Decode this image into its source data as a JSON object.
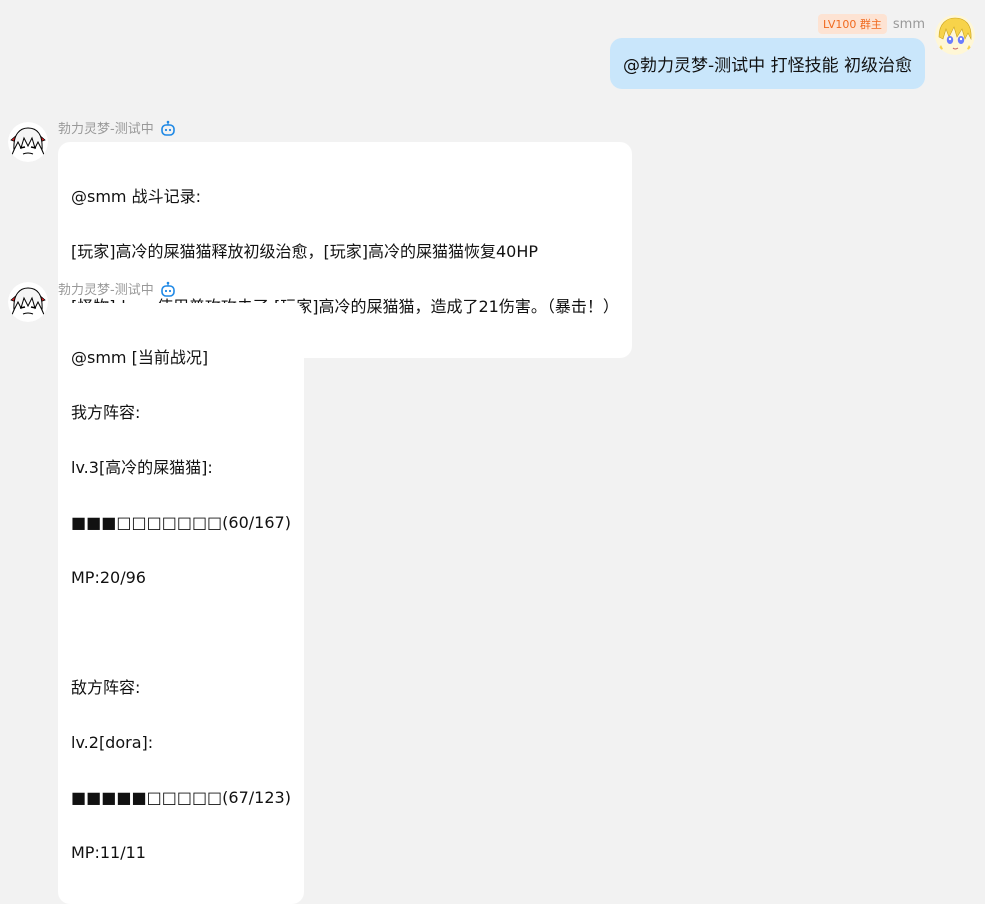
{
  "self_message": {
    "badge": "LV100 群主",
    "sender": "smm",
    "text": "@勃力灵梦-测试中 打怪技能 初级治愈"
  },
  "bot_messages": [
    {
      "sender": "勃力灵梦-测试中",
      "lines": [
        "@smm 战斗记录:",
        "[玩家]高冷的屎猫猫释放初级治愈，[玩家]高冷的屎猫猫恢复40HP",
        "[怪物]dora 使用普攻攻击了 [玩家]高冷的屎猫猫，造成了21伤害。（暴击！）"
      ]
    },
    {
      "sender": "勃力灵梦-测试中",
      "lines": [
        "@smm [当前战况]",
        "我方阵容:",
        "lv.3[高冷的屎猫猫]:",
        "■■■□□□□□□□(60/167)",
        "MP:20/96",
        "",
        "敌方阵容:",
        "lv.2[dora]:",
        "■■■■■□□□□□(67/123)",
        "MP:11/11"
      ]
    }
  ],
  "colors": {
    "background": "#f2f2f2",
    "self_bubble": "#c9e6fb",
    "bot_bubble": "#ffffff",
    "badge_bg": "#fde3d3",
    "badge_text": "#f06a1f",
    "bot_icon": "#1e88e5"
  },
  "icons": {
    "self_avatar": "blonde-anime-avatar-icon",
    "bot_avatar": "reimu-anime-avatar-icon",
    "bot_badge": "robot-icon"
  }
}
